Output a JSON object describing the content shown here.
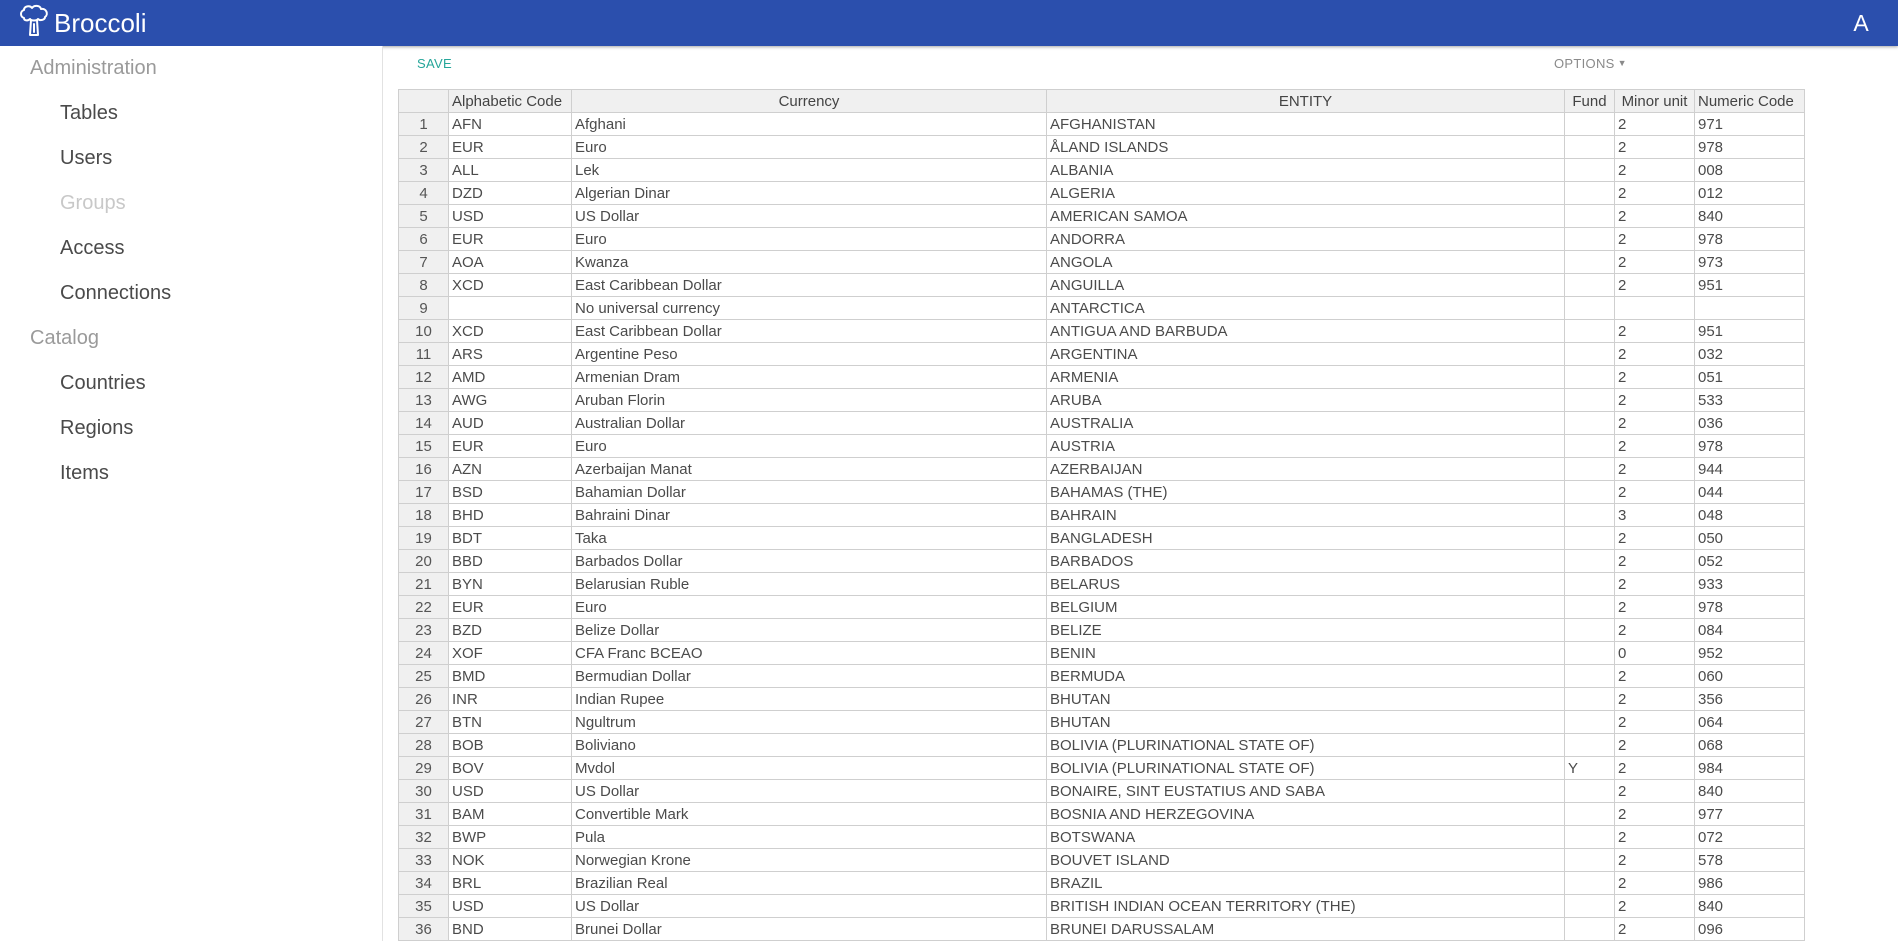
{
  "app": {
    "name": "Broccoli",
    "logo_icon": "broccoli-icon",
    "user_initial": "A",
    "accent": "#2b4fad"
  },
  "sidebar": {
    "admin_label": "Administration",
    "admin_items": [
      {
        "label": "Tables",
        "enabled": true
      },
      {
        "label": "Users",
        "enabled": true
      },
      {
        "label": "Groups",
        "enabled": false
      },
      {
        "label": "Access",
        "enabled": true
      },
      {
        "label": "Connections",
        "enabled": true
      }
    ],
    "catalog_label": "Catalog",
    "catalog_items": [
      {
        "label": "Countries"
      },
      {
        "label": "Regions"
      },
      {
        "label": "Items"
      }
    ]
  },
  "toolbar": {
    "save_label": "SAVE",
    "options_label": "OPTIONS",
    "options_icon": "caret-down-icon"
  },
  "table": {
    "columns": [
      "Alphabetic Code",
      "Currency",
      "ENTITY",
      "Fund",
      "Minor unit",
      "Numeric Code"
    ],
    "rows": [
      [
        "1",
        "AFN",
        "Afghani",
        "AFGHANISTAN",
        "",
        "2",
        "971"
      ],
      [
        "2",
        "EUR",
        "Euro",
        "ÅLAND ISLANDS",
        "",
        "2",
        "978"
      ],
      [
        "3",
        "ALL",
        "Lek",
        "ALBANIA",
        "",
        "2",
        "008"
      ],
      [
        "4",
        "DZD",
        "Algerian Dinar",
        "ALGERIA",
        "",
        "2",
        "012"
      ],
      [
        "5",
        "USD",
        "US Dollar",
        "AMERICAN SAMOA",
        "",
        "2",
        "840"
      ],
      [
        "6",
        "EUR",
        "Euro",
        "ANDORRA",
        "",
        "2",
        "978"
      ],
      [
        "7",
        "AOA",
        "Kwanza",
        "ANGOLA",
        "",
        "2",
        "973"
      ],
      [
        "8",
        "XCD",
        "East Caribbean Dollar",
        "ANGUILLA",
        "",
        "2",
        "951"
      ],
      [
        "9",
        "",
        "No universal currency",
        "ANTARCTICA",
        "",
        "",
        ""
      ],
      [
        "10",
        "XCD",
        "East Caribbean Dollar",
        "ANTIGUA AND BARBUDA",
        "",
        "2",
        "951"
      ],
      [
        "11",
        "ARS",
        "Argentine Peso",
        "ARGENTINA",
        "",
        "2",
        "032"
      ],
      [
        "12",
        "AMD",
        "Armenian Dram",
        "ARMENIA",
        "",
        "2",
        "051"
      ],
      [
        "13",
        "AWG",
        "Aruban Florin",
        "ARUBA",
        "",
        "2",
        "533"
      ],
      [
        "14",
        "AUD",
        "Australian Dollar",
        "AUSTRALIA",
        "",
        "2",
        "036"
      ],
      [
        "15",
        "EUR",
        "Euro",
        "AUSTRIA",
        "",
        "2",
        "978"
      ],
      [
        "16",
        "AZN",
        "Azerbaijan Manat",
        "AZERBAIJAN",
        "",
        "2",
        "944"
      ],
      [
        "17",
        "BSD",
        "Bahamian Dollar",
        "BAHAMAS (THE)",
        "",
        "2",
        "044"
      ],
      [
        "18",
        "BHD",
        "Bahraini Dinar",
        "BAHRAIN",
        "",
        "3",
        "048"
      ],
      [
        "19",
        "BDT",
        "Taka",
        "BANGLADESH",
        "",
        "2",
        "050"
      ],
      [
        "20",
        "BBD",
        "Barbados Dollar",
        "BARBADOS",
        "",
        "2",
        "052"
      ],
      [
        "21",
        "BYN",
        "Belarusian Ruble",
        "BELARUS",
        "",
        "2",
        "933"
      ],
      [
        "22",
        "EUR",
        "Euro",
        "BELGIUM",
        "",
        "2",
        "978"
      ],
      [
        "23",
        "BZD",
        "Belize Dollar",
        "BELIZE",
        "",
        "2",
        "084"
      ],
      [
        "24",
        "XOF",
        "CFA Franc BCEAO",
        "BENIN",
        "",
        "0",
        "952"
      ],
      [
        "25",
        "BMD",
        "Bermudian Dollar",
        "BERMUDA",
        "",
        "2",
        "060"
      ],
      [
        "26",
        "INR",
        "Indian Rupee",
        "BHUTAN",
        "",
        "2",
        "356"
      ],
      [
        "27",
        "BTN",
        "Ngultrum",
        "BHUTAN",
        "",
        "2",
        "064"
      ],
      [
        "28",
        "BOB",
        "Boliviano",
        "BOLIVIA (PLURINATIONAL STATE OF)",
        "",
        "2",
        "068"
      ],
      [
        "29",
        "BOV",
        "Mvdol",
        "BOLIVIA (PLURINATIONAL STATE OF)",
        "Y",
        "2",
        "984"
      ],
      [
        "30",
        "USD",
        "US Dollar",
        "BONAIRE, SINT EUSTATIUS AND SABA",
        "",
        "2",
        "840"
      ],
      [
        "31",
        "BAM",
        "Convertible Mark",
        "BOSNIA AND HERZEGOVINA",
        "",
        "2",
        "977"
      ],
      [
        "32",
        "BWP",
        "Pula",
        "BOTSWANA",
        "",
        "2",
        "072"
      ],
      [
        "33",
        "NOK",
        "Norwegian Krone",
        "BOUVET ISLAND",
        "",
        "2",
        "578"
      ],
      [
        "34",
        "BRL",
        "Brazilian Real",
        "BRAZIL",
        "",
        "2",
        "986"
      ],
      [
        "35",
        "USD",
        "US Dollar",
        "BRITISH INDIAN OCEAN TERRITORY (THE)",
        "",
        "2",
        "840"
      ],
      [
        "36",
        "BND",
        "Brunei Dollar",
        "BRUNEI DARUSSALAM",
        "",
        "2",
        "096"
      ]
    ]
  }
}
